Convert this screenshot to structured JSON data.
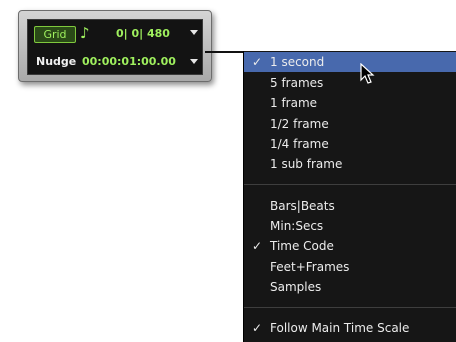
{
  "panel": {
    "grid_label": "Grid",
    "grid_icon": "eighth-note-icon",
    "grid_icon_glyph": "♪",
    "grid_value": "0| 0| 480",
    "nudge_label": "Nudge",
    "nudge_value": "00:00:01:00.00"
  },
  "menu": {
    "items": [
      {
        "check": "✓",
        "label": "1 second"
      },
      {
        "check": "",
        "label": "5 frames"
      },
      {
        "check": "",
        "label": "1 frame"
      },
      {
        "check": "",
        "label": "1/2 frame"
      },
      {
        "check": "",
        "label": "1/4 frame"
      },
      {
        "check": "",
        "label": "1 sub frame"
      },
      {
        "check": "",
        "label": "Bars|Beats"
      },
      {
        "check": "",
        "label": "Min:Secs"
      },
      {
        "check": "✓",
        "label": "Time Code"
      },
      {
        "check": "",
        "label": "Feet+Frames"
      },
      {
        "check": "",
        "label": "Samples"
      },
      {
        "check": "✓",
        "label": "Follow Main Time Scale"
      }
    ]
  },
  "colors": {
    "accent_green": "#9ff05e",
    "menu_background": "#161616",
    "menu_highlight": "#4869ad"
  }
}
